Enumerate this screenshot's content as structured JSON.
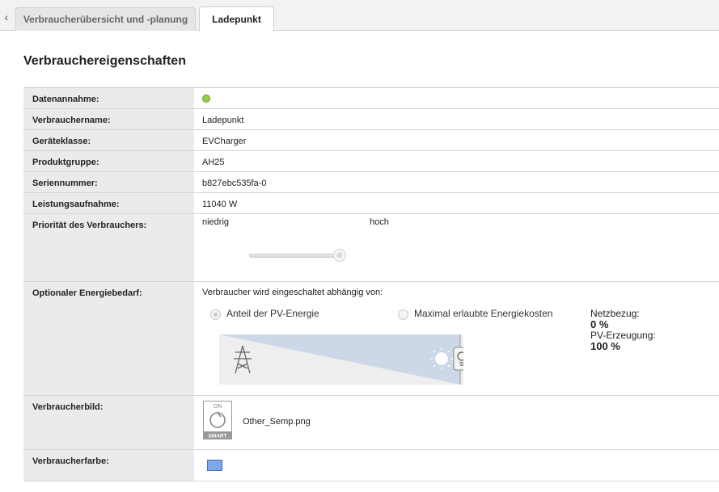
{
  "tabs": {
    "back_glyph": "‹",
    "overview": "Verbraucherübersicht und -planung",
    "active": "Ladepunkt"
  },
  "section_title": "Verbrauchereigenschaften",
  "props": {
    "datenannahme_label": "Datenannahme:",
    "datenannahme_status_color": "#9acd47",
    "name_label": "Verbrauchername:",
    "name_value": "Ladepunkt",
    "klasse_label": "Geräteklasse:",
    "klasse_value": "EVCharger",
    "gruppe_label": "Produktgruppe:",
    "gruppe_value": "AH25",
    "serien_label": "Seriennummer:",
    "serien_value": "b827ebc535fa-0",
    "leistung_label": "Leistungsaufnahme:",
    "leistung_value": "11040 W",
    "prio_label": "Priorität des Verbrauchers:",
    "prio_low": "niedrig",
    "prio_high": "hoch",
    "prio_level": 1.0,
    "energy_label": "Optionaler Energiebedarf:",
    "energy_intro": "Verbraucher wird eingeschaltet abhängig von:",
    "radio_pv": "Anteil der PV-Energie",
    "radio_cost": "Maximal erlaubte Energiekosten",
    "radio_selected": "Anteil der PV-Energie",
    "netzbezug_label": "Netzbezug:",
    "netzbezug_value": "0 %",
    "pv_label": "PV-Erzeugung:",
    "pv_value": "100 %",
    "bild_label": "Verbraucherbild:",
    "bild_icon_text_top": "ON",
    "bild_icon_text_bottom": "SMART",
    "bild_file": "Other_Semp.png",
    "farbe_label": "Verbraucherfarbe:",
    "farbe_color": "#7fa8e8"
  }
}
